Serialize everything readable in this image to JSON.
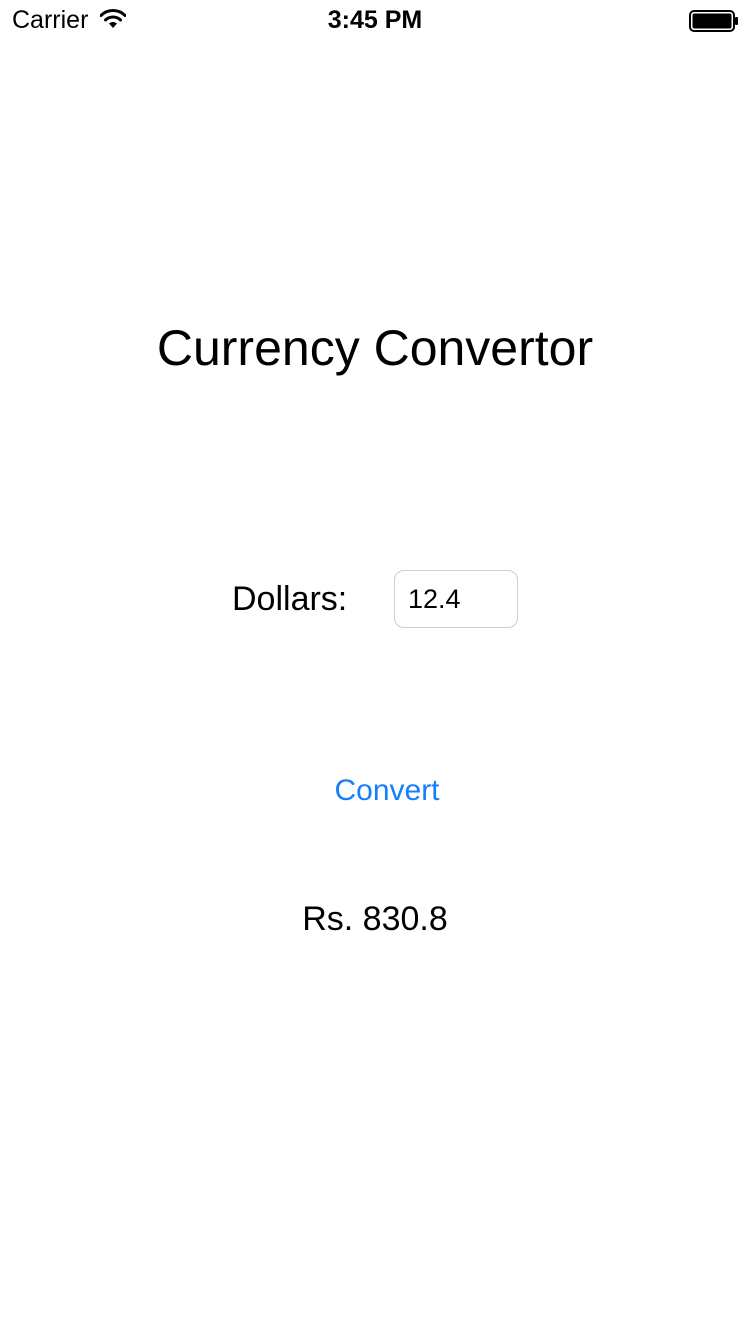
{
  "status_bar": {
    "carrier": "Carrier",
    "time": "3:45 PM",
    "wifi_icon": "wifi-icon",
    "battery_icon": "battery-full-icon"
  },
  "main": {
    "title": "Currency Convertor",
    "dollars_label": "Dollars:",
    "amount_value": "12.4",
    "convert_label": "Convert",
    "result": "Rs. 830.8"
  },
  "colors": {
    "background": "#ffffff",
    "text": "#000000",
    "accent": "#147efb",
    "input_border": "#cfcfcf"
  }
}
